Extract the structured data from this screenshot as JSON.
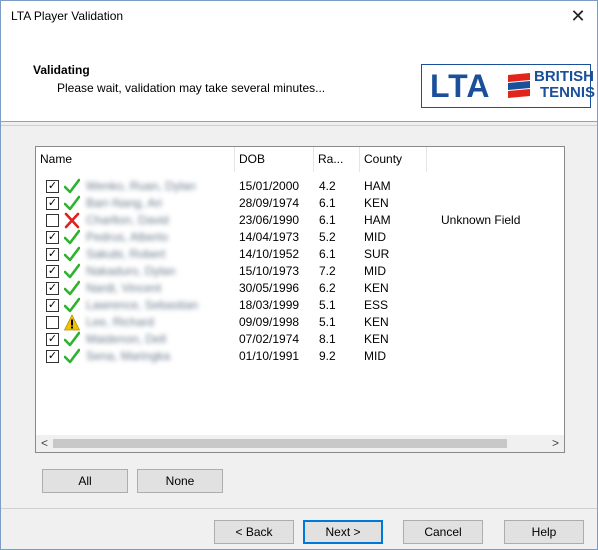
{
  "window": {
    "title": "LTA Player Validation",
    "close_glyph": "✕"
  },
  "header": {
    "title": "Validating",
    "subtitle": "Please wait, validation may take several minutes...",
    "logo": {
      "lta": "LTA",
      "line1": "BRITISH",
      "line2": "TENNIS",
      "color": "#1a4f9a",
      "flag_red": "#e1251b"
    }
  },
  "list": {
    "columns": {
      "name": "Name",
      "dob": "DOB",
      "rating": "Ra...",
      "county": "County"
    },
    "rows": [
      {
        "checked": true,
        "status": "check-icon",
        "name": "Wenko, Ruan, Dylan",
        "dob": "15/01/2000",
        "rating": "4.2",
        "county": "HAM",
        "note": ""
      },
      {
        "checked": true,
        "status": "check-icon",
        "name": "Barr-Nang, Ari",
        "dob": "28/09/1974",
        "rating": "6.1",
        "county": "KEN",
        "note": ""
      },
      {
        "checked": false,
        "status": "cross-icon",
        "name": "Charlton, David",
        "dob": "23/06/1990",
        "rating": "6.1",
        "county": "HAM",
        "note": "Unknown Field"
      },
      {
        "checked": true,
        "status": "check-icon",
        "name": "Pedrus, Alberto",
        "dob": "14/04/1973",
        "rating": "5.2",
        "county": "MID",
        "note": ""
      },
      {
        "checked": true,
        "status": "check-icon",
        "name": "Sakubi, Robert",
        "dob": "14/10/1952",
        "rating": "6.1",
        "county": "SUR",
        "note": ""
      },
      {
        "checked": true,
        "status": "check-icon",
        "name": "Nakaduro, Dylan",
        "dob": "15/10/1973",
        "rating": "7.2",
        "county": "MID",
        "note": ""
      },
      {
        "checked": true,
        "status": "check-icon",
        "name": "Nardi, Vincent",
        "dob": "30/05/1996",
        "rating": "6.2",
        "county": "KEN",
        "note": ""
      },
      {
        "checked": true,
        "status": "check-icon",
        "name": "Lawrence, Sebastian",
        "dob": "18/03/1999",
        "rating": "5.1",
        "county": "ESS",
        "note": ""
      },
      {
        "checked": false,
        "status": "warning-icon",
        "name": "Lee, Richard",
        "dob": "09/09/1998",
        "rating": "5.1",
        "county": "KEN",
        "note": ""
      },
      {
        "checked": true,
        "status": "check-icon",
        "name": "Maidenon, Dell",
        "dob": "07/02/1974",
        "rating": "8.1",
        "county": "KEN",
        "note": ""
      },
      {
        "checked": true,
        "status": "check-icon",
        "name": "Sena, Maringka",
        "dob": "01/10/1991",
        "rating": "9.2",
        "county": "MID",
        "note": ""
      }
    ],
    "scroll_left": "<",
    "scroll_right": ">"
  },
  "selection_buttons": {
    "all": "All",
    "none": "None"
  },
  "footer": {
    "back": "< Back",
    "next": "Next >",
    "cancel": "Cancel",
    "help": "Help"
  },
  "colors": {
    "check": "#2fb22f",
    "cross": "#e02020",
    "warning": "#f2c200",
    "focus": "#0078d7"
  }
}
